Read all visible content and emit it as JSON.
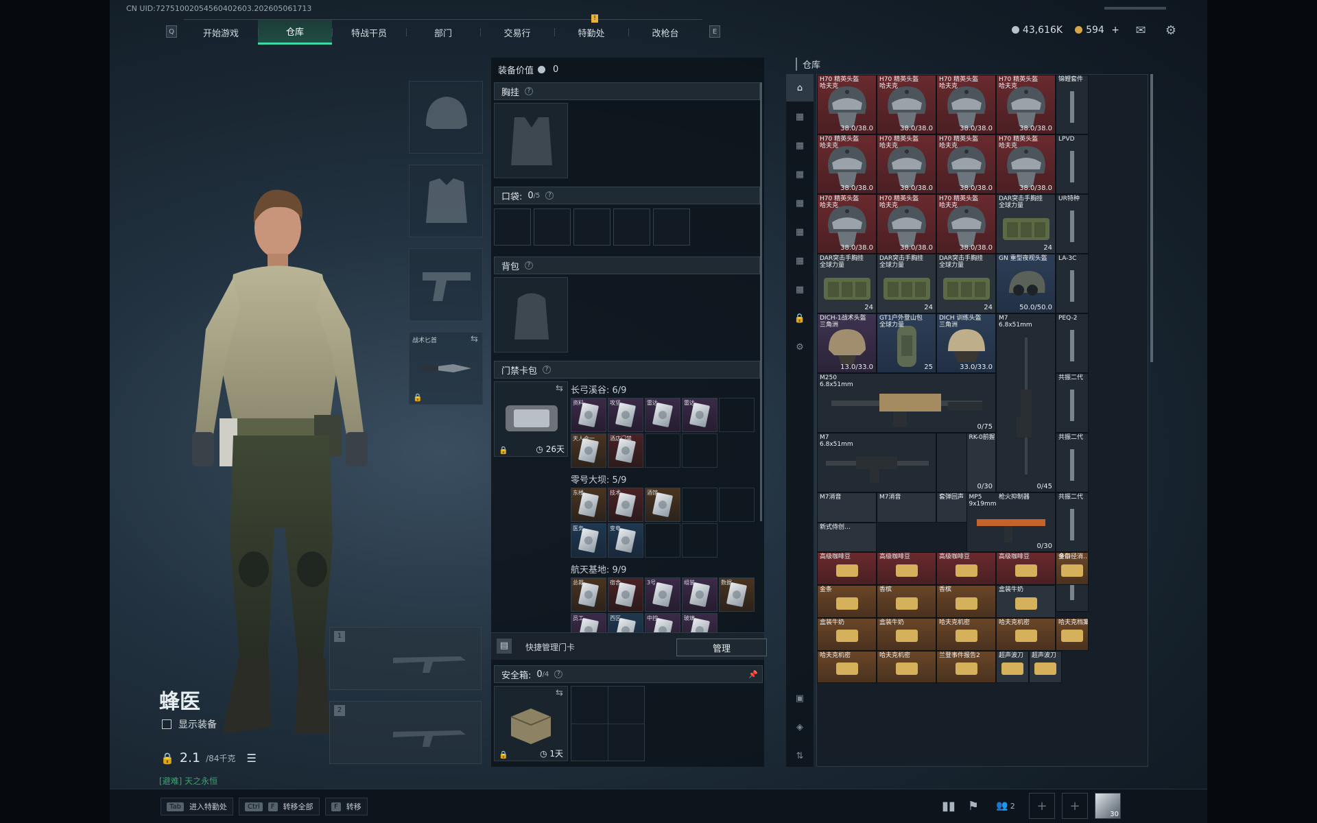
{
  "uid": "CN UID:72751002054560402603.202605061713",
  "nav": {
    "key_left": "Q",
    "key_right": "E",
    "tabs": [
      {
        "label": "开始游戏"
      },
      {
        "label": "仓库"
      },
      {
        "label": "特战干员"
      },
      {
        "label": "部门"
      },
      {
        "label": "交易行"
      },
      {
        "label": "特勤处"
      },
      {
        "label": "改枪台"
      }
    ],
    "alert_badge": "!"
  },
  "currency": {
    "silver": "43,616K",
    "gold": "594",
    "add": "+"
  },
  "character": {
    "name": "蜂医",
    "show_equipment_label": "显示装备",
    "weight_value": "2.1",
    "weight_cap": "/84千克",
    "location": "[避难] 天之永恒"
  },
  "equip_slots": {
    "knife_label": "战术匕首"
  },
  "weapon_slots": [
    "1",
    "2"
  ],
  "middle": {
    "equipment_value_label": "装备价值",
    "equipment_value": "0",
    "chest_rig": "胸挂",
    "pocket_label": "口袋:",
    "pocket_count": "0",
    "pocket_total": "/5",
    "backpack": "背包",
    "keycard_bag": "门禁卡包",
    "keycard_days": "26天",
    "maps": [
      {
        "name": "长弓溪谷: 6/9"
      },
      {
        "name": "零号大坝: 5/9"
      },
      {
        "name": "航天基地: 9/9"
      }
    ],
    "card_caps_1": [
      "资料",
      "攻坚",
      "雷达",
      "雷达",
      "天人合一",
      "酒店门禁"
    ],
    "card_caps_2": [
      "东楼",
      "技术",
      "酒馆",
      "医务",
      "变电"
    ],
    "card_caps_3": [
      "总裁",
      "宿舍",
      "3号",
      "组装",
      "数据",
      "员工",
      "西区",
      "中控",
      "玻璃"
    ],
    "quick_manage_label": "快捷管理门卡",
    "manage_button": "管理",
    "safe_box_label": "安全箱:",
    "safe_box_count": "0",
    "safe_box_total": "/4",
    "safe_box_days": "1天"
  },
  "warehouse": {
    "title": "仓库",
    "items": [
      {
        "name": "H70 精英头盔\n哈夫克",
        "dur": "38.0/38.0"
      },
      {
        "name": "H70 精英头盔\n哈夫克",
        "dur": "38.0/38.0"
      },
      {
        "name": "H70 精英头盔\n哈夫克",
        "dur": "38.0/38.0"
      },
      {
        "name": "H70 精英头盔\n哈夫克",
        "dur": "38.0/38.0"
      },
      {
        "name": "H70 精英头盔\n哈夫克",
        "dur": "38.0/38.0"
      },
      {
        "name": "H70 精英头盔\n哈夫克",
        "dur": "38.0/38.0"
      },
      {
        "name": "H70 精英头盔\n哈夫克",
        "dur": "38.0/38.0"
      },
      {
        "name": "H70 精英头盔\n哈夫克",
        "dur": "38.0/38.0"
      },
      {
        "name": "H70 精英头盔\n哈夫克",
        "dur": "38.0/38.0"
      },
      {
        "name": "H70 精英头盔\n哈夫克",
        "dur": "38.0/38.0"
      },
      {
        "name": "H70 精英头盔\n哈夫克",
        "dur": "38.0/38.0"
      }
    ],
    "dar_name": "DAR突击手胸挂\n全球力量",
    "dar_count": "24",
    "gn_name": "GN 重型夜视头盔",
    "gn_dur": "50.0/50.0",
    "dich_name": "DICH-1战术头盔\n三角洲",
    "dich_dur": "13.0/33.0",
    "gt_name": "GT1户外登山包\n全球力量",
    "gt_count": "25",
    "dich2_name": "DICH 训练头盔\n三角洲",
    "dich2_dur": "33.0/33.0",
    "m7_long_name": "M7\n6.8x51mm",
    "m250_name": "M250\n6.8x51mm",
    "m250_ammo": "0/75",
    "m7_name": "M7\n6.8x51mm",
    "m7_ammo": "0/30",
    "m7_long_ammo": "0/45",
    "rk_name": "RK-0前握",
    "mp5_name": "MP5\n9x19mm",
    "mp5_ammo": "0/30",
    "att_names": [
      "M7消音",
      "M7消音",
      "套弹回声",
      "枪火抑制器",
      "新式侍创…"
    ],
    "side_names": [
      "锦鲤套件",
      "LPVD",
      "UR特种",
      "LA-3C",
      "PEQ-2",
      "共振二代",
      "共振二代",
      "共振二代",
      "多口径消…"
    ],
    "loot_row1": [
      "高级咖啡豆",
      "高级咖啡豆",
      "高级咖啡豆",
      "高级咖啡豆",
      "金条"
    ],
    "loot_row2": [
      "金条",
      "香槟",
      "香槟",
      "盒装牛奶"
    ],
    "loot_row3": [
      "盒装牛奶",
      "盒装牛奶",
      "哈夫克机密",
      "哈夫克机密",
      "哈夫克档案"
    ],
    "loot_row4": [
      "哈夫克机密",
      "哈夫克机密",
      "兰登事件报告2",
      "超声波刀",
      "超声波刀"
    ]
  },
  "bottom": {
    "hint1_key": "Tab",
    "hint1_label": "进入特勤处",
    "hint2_key": "Ctrl",
    "hint2_key2": "F",
    "hint2_label": "转移全部",
    "hint3_key": "F",
    "hint3_label": "转移",
    "squad_count": "2",
    "level": "30"
  },
  "colors": {
    "accent": "#3fd9a8",
    "rare_red": "#6a2a2e",
    "gold": "#e8b23a"
  }
}
